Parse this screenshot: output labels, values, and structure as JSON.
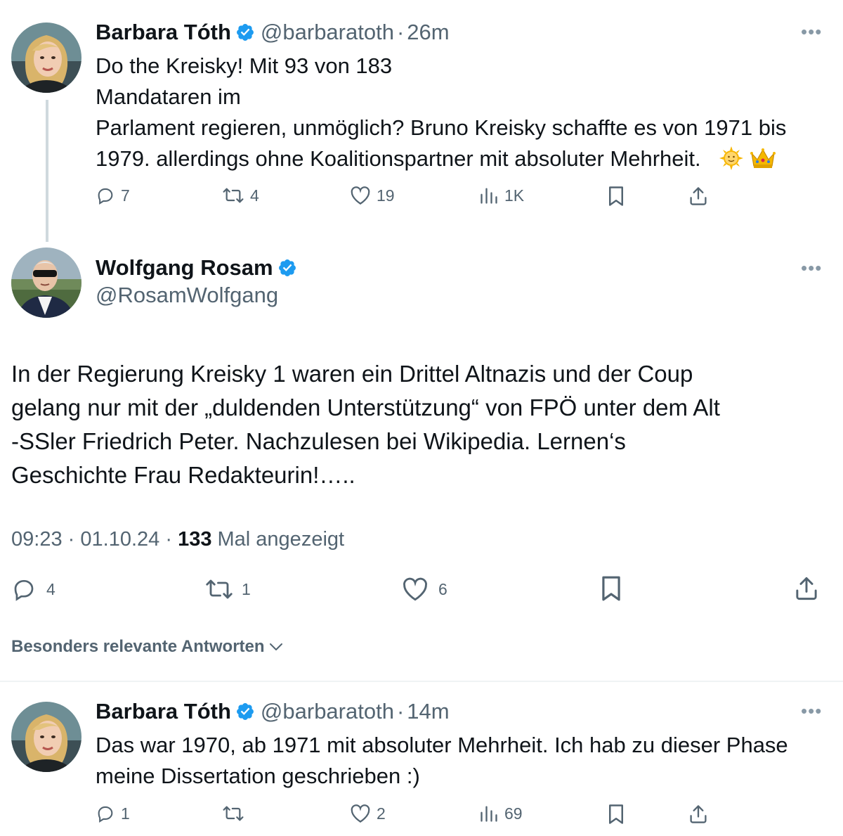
{
  "tweet1": {
    "name": "Barbara Tóth",
    "handle": "@barbaratoth",
    "separator": "·",
    "time": "26m",
    "lines": [
      "Do the Kreisky! Mit 93 von 183",
      "Mandataren im",
      "Parlament regieren, unmöglich? Bruno Kreisky schaffte es von 1971 bis",
      "1979. allerdings ohne Koalitionspartner mit absoluter Mehrheit."
    ],
    "emojis": [
      "sun-face-emoji",
      "crown-emoji"
    ],
    "actions": {
      "replies": "7",
      "retweets": "4",
      "likes": "19",
      "views": "1K"
    }
  },
  "tweet2": {
    "name": "Wolfgang Rosam",
    "handle": "@RosamWolfgang",
    "lines": [
      "In der Regierung Kreisky 1 waren ein Drittel Altnazis und der Coup",
      "gelang nur mit der „duldenden Unterstützung“ von FPÖ unter dem Alt",
      "-SSler Friedrich Peter. Nachzulesen bei Wikipedia. Lernen‘s",
      "Geschichte Frau Redakteurin!….."
    ],
    "time": "09:23",
    "date": "01.10.24",
    "separator": "·",
    "views_count": "133",
    "views_label": "Mal angezeigt",
    "actions": {
      "replies": "4",
      "retweets": "1",
      "likes": "6"
    }
  },
  "sort": {
    "label": "Besonders relevante Antworten"
  },
  "tweet3": {
    "name": "Barbara Tóth",
    "handle": "@barbaratoth",
    "separator": "·",
    "time": "14m",
    "lines": [
      "Das war 1970, ab 1971 mit absoluter Mehrheit. Ich hab zu dieser Phase",
      "meine Dissertation geschrieben :)"
    ],
    "actions": {
      "replies": "1",
      "retweets": "",
      "likes": "2",
      "views": "69"
    }
  },
  "icons": {
    "verified": "verified-badge-icon",
    "reply": "reply-icon",
    "retweet": "retweet-icon",
    "like": "heart-icon",
    "views": "views-chart-icon",
    "bookmark": "bookmark-icon",
    "share": "share-icon",
    "more": "more-options-icon"
  },
  "colors": {
    "text": "#0f1419",
    "secondary": "#536471",
    "verified": "#1d9bf0",
    "thread_line": "#cfd9de",
    "divider": "#eff3f4"
  }
}
